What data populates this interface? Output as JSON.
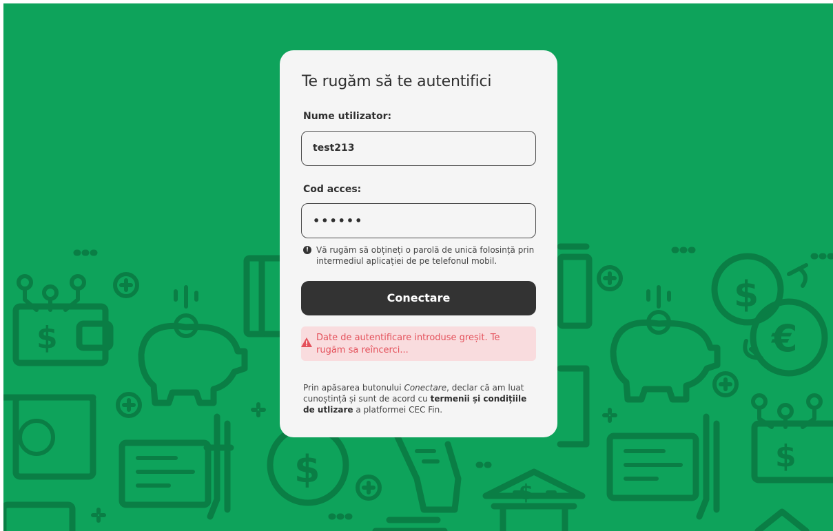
{
  "login": {
    "title": "Te rugăm să te autentifici",
    "username_label": "Nume utilizator:",
    "username_value": "test213",
    "password_label": "Cod acces:",
    "password_value": "••••••",
    "hint": "Vă rugăm să obțineți o parolă de unică folosință prin intermediul aplicației de pe telefonul mobil.",
    "submit_label": "Conectare",
    "error_message": "Date de autentificare introduse greșit. Te rugăm sa reîncerci...",
    "terms": {
      "prefix": "Prin apăsarea butonului ",
      "button_ref": "Conectare",
      "middle": ", declar că am luat cunoștință și sunt de acord cu ",
      "link": "termenii și condițiile de utlizare",
      "suffix": " a platformei CEC Fin."
    }
  },
  "colors": {
    "background": "#0ea35b",
    "pattern": "#0a7e45",
    "card": "#f5f5f5",
    "button": "#333333",
    "error_bg": "#f9dcde",
    "error_text": "#e4515b"
  },
  "icons": [
    "info-icon",
    "warning-icon",
    "wallet-icon",
    "piggy-bank-icon",
    "coin-icon",
    "bank-icon",
    "plus-icon",
    "euro-icon",
    "dollar-icon"
  ]
}
